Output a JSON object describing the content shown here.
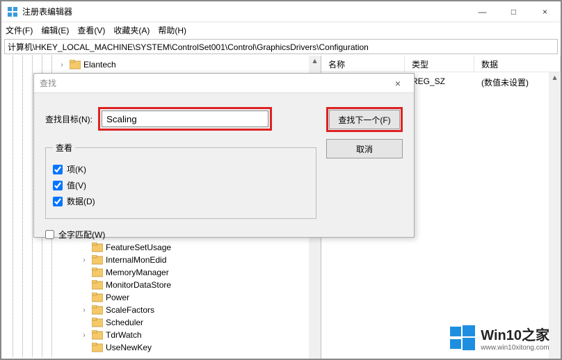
{
  "window": {
    "title": "注册表编辑器",
    "minimize": "—",
    "maximize": "□",
    "close": "×"
  },
  "menu": {
    "file": "文件(F)",
    "edit": "编辑(E)",
    "view": "查看(V)",
    "favorites": "收藏夹(A)",
    "help": "帮助(H)"
  },
  "address": "计算机\\HKEY_LOCAL_MACHINE\\SYSTEM\\ControlSet001\\Control\\GraphicsDrivers\\Configuration",
  "tree": {
    "items": [
      {
        "label": "Elantech",
        "expandable": true
      },
      {
        "label": "FeatureSetUsage",
        "expandable": false
      },
      {
        "label": "InternalMonEdid",
        "expandable": true
      },
      {
        "label": "MemoryManager",
        "expandable": false
      },
      {
        "label": "MonitorDataStore",
        "expandable": false
      },
      {
        "label": "Power",
        "expandable": false
      },
      {
        "label": "ScaleFactors",
        "expandable": true
      },
      {
        "label": "Scheduler",
        "expandable": false
      },
      {
        "label": "TdrWatch",
        "expandable": true
      },
      {
        "label": "UseNewKey",
        "expandable": false
      }
    ]
  },
  "list": {
    "headers": {
      "name": "名称",
      "type": "类型",
      "data": "数据"
    },
    "row": {
      "type": "REG_SZ",
      "data": "(数值未设置)"
    }
  },
  "find": {
    "title": "查找",
    "close": "×",
    "target_label": "查找目标(N):",
    "target_value": "Scaling",
    "findnext_label": "查找下一个(F)",
    "cancel_label": "取消",
    "lookat_legend": "查看",
    "keys_label": "项(K)",
    "values_label": "值(V)",
    "data_label": "数据(D)",
    "wholeword_label": "全字匹配(W)",
    "keys_checked": true,
    "values_checked": true,
    "data_checked": true,
    "wholeword_checked": false
  },
  "watermark": {
    "brand": "Win10之家",
    "url": "www.win10xitong.com"
  }
}
